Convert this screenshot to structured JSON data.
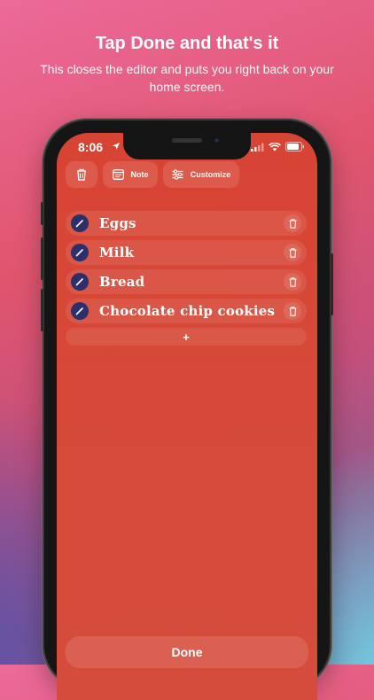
{
  "header": {
    "title": "Tap Done and that's it",
    "subtitle": "This closes the editor and puts you right back on your home screen."
  },
  "status_bar": {
    "time": "8:06"
  },
  "toolbar": {
    "note_label": "Note",
    "customize_label": "Customize"
  },
  "list": {
    "items": [
      {
        "label": "Eggs"
      },
      {
        "label": "Milk"
      },
      {
        "label": "Bread"
      },
      {
        "label": "Chocolate chip cookies"
      }
    ],
    "add_label": "+"
  },
  "footer": {
    "done_label": "Done"
  },
  "colors": {
    "screen_bg": "#d84434",
    "pen_circle": "#2d2f6b",
    "text": "#ffffff"
  },
  "icons": [
    "trash-icon",
    "note-icon",
    "sliders-icon",
    "pencil-icon",
    "location-arrow-icon",
    "signal-icon",
    "wifi-icon",
    "battery-icon"
  ]
}
